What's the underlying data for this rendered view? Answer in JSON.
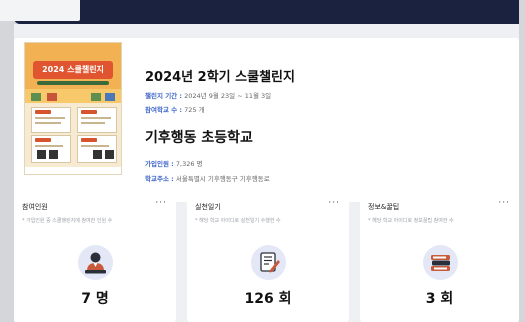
{
  "topbar": {
    "tab_label": ""
  },
  "program": {
    "title": "2024년 2학기 스쿨챌린지",
    "period_label": "챌린지 기간 :",
    "period_value": "2024년 9월 23일 ~ 11월 3일",
    "schools_label": "참여학교 수 :",
    "schools_value": "725 개"
  },
  "school": {
    "name": "기후행동 초등학교",
    "members_label": "가입인원 :",
    "members_value": "7,326 명",
    "address_label": "학교주소 :",
    "address_value": "서울특별시 기후행동구 기후행동로"
  },
  "stats": [
    {
      "title": "참여인원",
      "desc": "* 가입인원 중 스쿨챌린지에 참여한 인원 수",
      "value": "7 명",
      "icon": "person-icon"
    },
    {
      "title": "실천일기",
      "desc": "* 해당 학교 아이디로 실천일기 수행한 수",
      "value": "126 회",
      "icon": "diary-icon"
    },
    {
      "title": "정보&꿀팁",
      "desc": "* 해당 학교 아이디로 정보꿀팁 참여한 수",
      "value": "3 회",
      "icon": "books-icon"
    }
  ],
  "more_label": "···",
  "colors": {
    "topbar": "#1b2240",
    "label_blue": "#3c64c8",
    "icon_bg": "#e3e7f6"
  }
}
